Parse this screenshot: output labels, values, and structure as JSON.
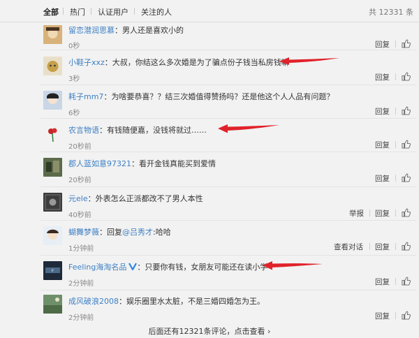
{
  "tabs": [
    "全部",
    "热门",
    "认证用户",
    "关注的人"
  ],
  "total_label": "共 12331 条",
  "actions": {
    "reply": "回复",
    "report": "举报",
    "view_conversation": "查看对话"
  },
  "comments": [
    {
      "user": "留恋潜润思慕",
      "sep": "：",
      "text": "男人还是喜欢小的",
      "time": "0秒"
    },
    {
      "user": "小鞋子xxz",
      "sep": "：",
      "text": "大叔，你结这么多次婚是为了骗点份子钱当私房钱嘛",
      "time": "3秒"
    },
    {
      "user": "耗子mm7",
      "sep": "：",
      "text": "为啥要恭喜？？结三次婚值得赞扬吗？还是他这个人人品有问题？",
      "time": "6秒"
    },
    {
      "user": "农言物语",
      "sep": "：",
      "text": "有钱随便嘉，没钱将就过……",
      "time": "20秒前"
    },
    {
      "user": "郡人蓝如意97321",
      "sep": "：",
      "text": "看开金钱真能买到爱情",
      "time": "20秒前"
    },
    {
      "user": "元ele",
      "sep": "：",
      "text": "外表怎么正派都改不了男人本性",
      "time": "40秒前"
    },
    {
      "user": "蝴舞梦薇",
      "sep": "：",
      "reply_prefix": "回复",
      "mention": "@吕秀才",
      "text": ":哈哈",
      "time": "1分钟前"
    },
    {
      "user": "Feeling海淘名品",
      "sep": "：",
      "text": "只要你有钱，女朋友可能还在读小学",
      "time": "2分钟前"
    },
    {
      "user": "成风破浪2008",
      "sep": "：",
      "text": "娱乐圈里水太脏，不是三婚四婚怎为王。",
      "time": "2分钟前"
    }
  ],
  "more_label": "后面还有12321条评论，点击查看",
  "colors": {
    "link": "#3d7fc4",
    "arrow": "#e0222a",
    "verified": "#2e86de"
  }
}
